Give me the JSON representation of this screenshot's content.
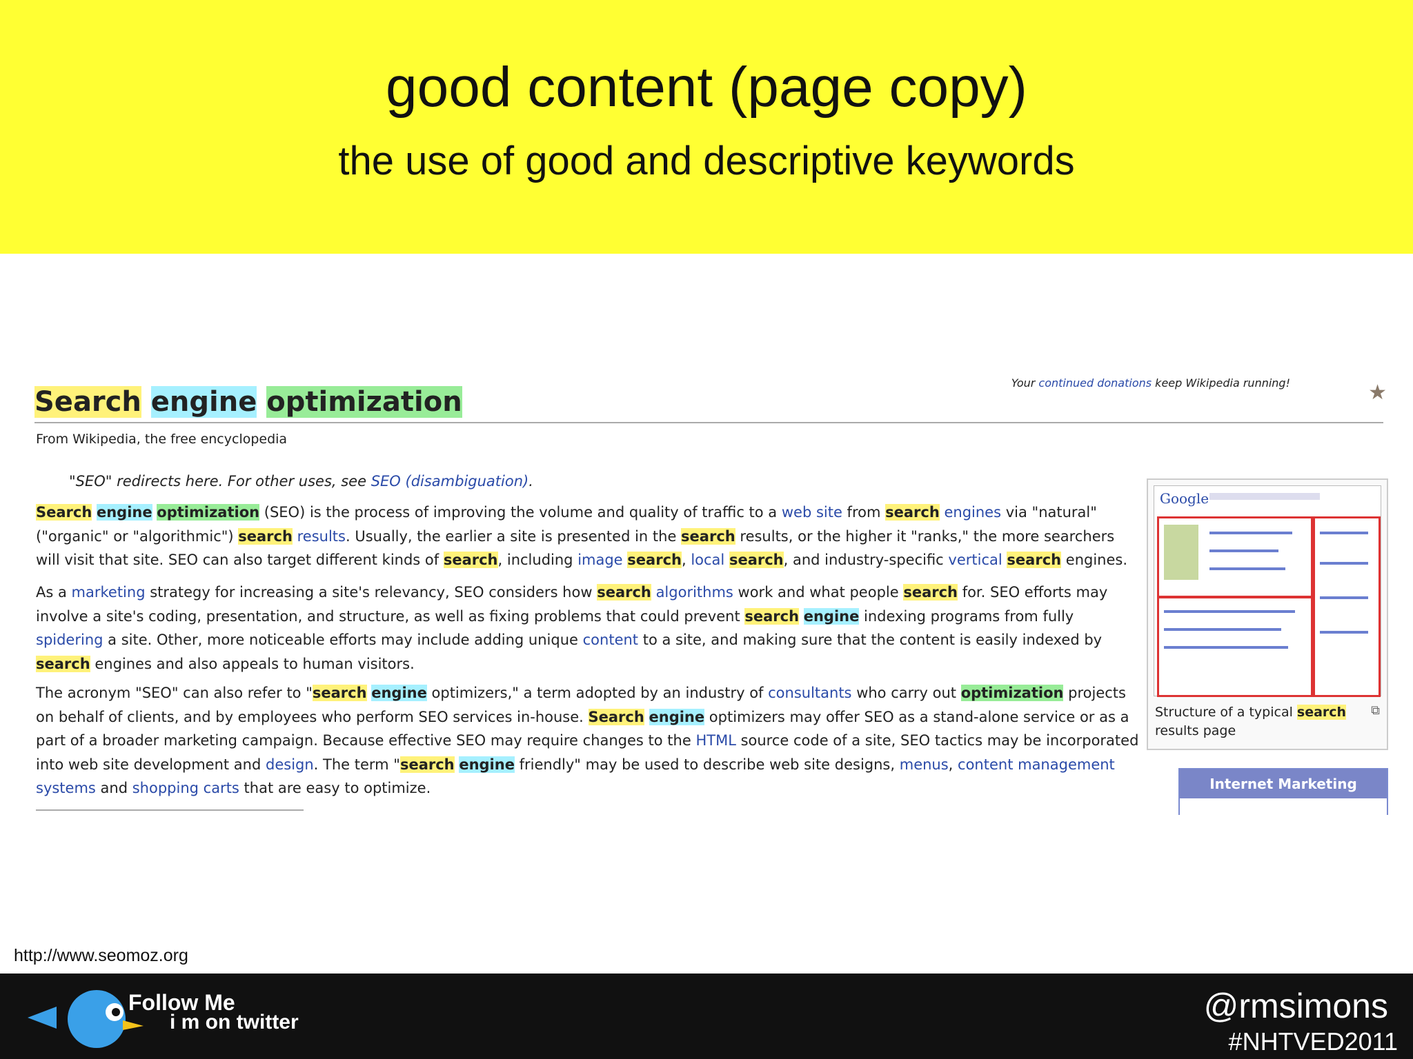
{
  "slide": {
    "title": "good content (page copy)",
    "subtitle": "the use of good and descriptive keywords",
    "banner_color": "#ffff33"
  },
  "wiki": {
    "donate_pre": "Your ",
    "donate_link": "continued donations",
    "donate_post": " keep Wikipedia running!",
    "star_icon": "star-icon",
    "title_words": [
      "Search",
      "engine",
      "optimization"
    ],
    "from": "From Wikipedia, the free encyclopedia",
    "redirect_pre": "\"SEO\" redirects here. For other uses, see ",
    "redirect_link": "SEO (disambiguation)",
    "redirect_post": ".",
    "thumb_logo": "Google",
    "thumb_caption_pre": "Structure of a typical ",
    "thumb_caption_kw": "search",
    "thumb_caption_post": " results page",
    "navbox_title": "Internet Marketing",
    "highlight_colors": {
      "search": "#fff27a",
      "engine": "#a6f0ff",
      "optimization": "#98ec98"
    }
  },
  "source_url": "http://www.seomoz.org",
  "footer": {
    "follow_line1": "Follow Me",
    "follow_line2": "i m on twitter",
    "handle": "@rmsimons",
    "hashtag": "#NHTVED2011"
  }
}
